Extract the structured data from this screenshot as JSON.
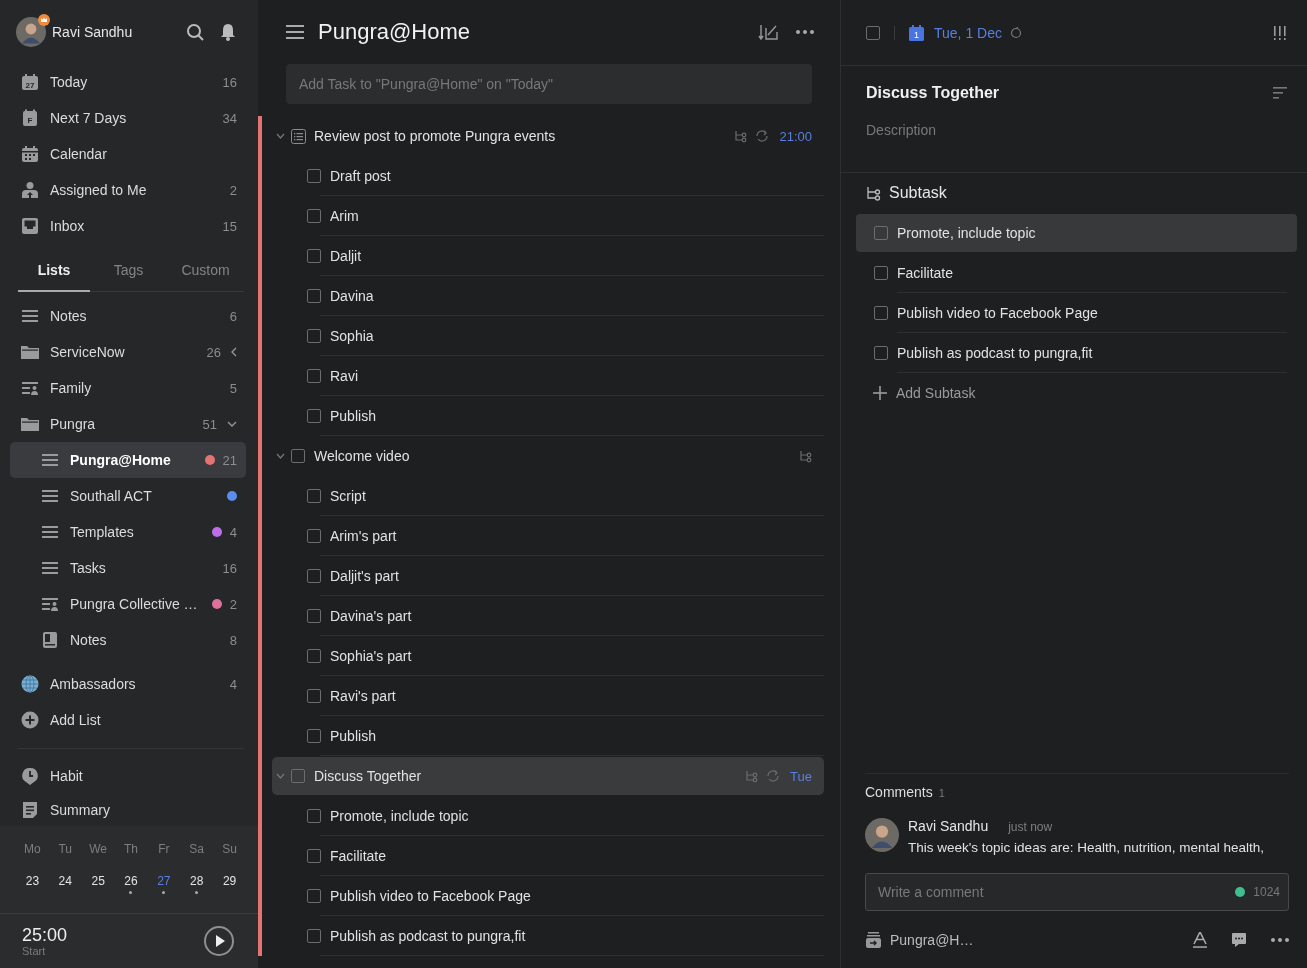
{
  "sidebar": {
    "user": {
      "name": "Ravi Sandhu"
    },
    "smart_lists": [
      {
        "kind": "today",
        "icon_text": "27",
        "label": "Today",
        "count": "16"
      },
      {
        "kind": "week",
        "icon_text": "F",
        "label": "Next 7 Days",
        "count": "34"
      },
      {
        "kind": "calendar",
        "label": "Calendar"
      },
      {
        "kind": "assigned",
        "label": "Assigned to Me",
        "count": "2"
      },
      {
        "kind": "inbox",
        "label": "Inbox",
        "count": "15"
      }
    ],
    "tabs": [
      {
        "label": "Lists",
        "selected": true
      },
      {
        "label": "Tags",
        "selected": false
      },
      {
        "label": "Custom",
        "selected": false
      }
    ],
    "lists": [
      {
        "kind": "list",
        "label": "Notes",
        "count": "6",
        "selected": false
      },
      {
        "kind": "folder",
        "label": "ServiceNow",
        "count": "26",
        "expanded": false,
        "selected": false
      },
      {
        "kind": "shared",
        "label": "Family",
        "count": "5",
        "selected": false
      },
      {
        "kind": "folder",
        "label": "Pungra",
        "count": "51",
        "expanded": true,
        "selected": false,
        "children": [
          {
            "kind": "list",
            "label": "Pungra@Home",
            "color": "#e57373",
            "count": "21",
            "selected": true
          },
          {
            "kind": "list",
            "label": "Southall ACT",
            "color": "#5b8def",
            "selected": false
          },
          {
            "kind": "list",
            "label": "Templates",
            "color": "#c06ee8",
            "count": "4",
            "selected": false
          },
          {
            "kind": "list",
            "label": "Tasks",
            "count": "16",
            "selected": false
          },
          {
            "kind": "shared",
            "label": "Pungra Collective …",
            "color": "#e0709a",
            "count": "2",
            "selected": false
          },
          {
            "kind": "notebook",
            "label": "Notes",
            "count": "8",
            "selected": false
          }
        ]
      },
      {
        "kind": "globe",
        "label": "Ambassadors",
        "count": "4",
        "selected": false
      },
      {
        "kind": "add",
        "label": "Add List",
        "selected": false
      }
    ],
    "extras": [
      {
        "kind": "habit",
        "label": "Habit"
      },
      {
        "kind": "summary",
        "label": "Summary"
      }
    ],
    "week": [
      {
        "weekday": "Mo",
        "date": "23",
        "selected": false,
        "has_tasks": false
      },
      {
        "weekday": "Tu",
        "date": "24",
        "selected": false,
        "has_tasks": false
      },
      {
        "weekday": "We",
        "date": "25",
        "selected": false,
        "has_tasks": false
      },
      {
        "weekday": "Th",
        "date": "26",
        "selected": false,
        "has_tasks": true
      },
      {
        "weekday": "Fr",
        "date": "27",
        "selected": true,
        "has_tasks": true
      },
      {
        "weekday": "Sa",
        "date": "28",
        "selected": false,
        "has_tasks": true
      },
      {
        "weekday": "Su",
        "date": "29",
        "selected": false,
        "has_tasks": false
      }
    ],
    "pomodoro": {
      "time": "25:00",
      "action": "Start"
    }
  },
  "list": {
    "title": "Pungra@Home",
    "add_placeholder": "Add Task to \"Pungra@Home\" on \"Today\"",
    "tasks": [
      {
        "kind": "note",
        "title": "Review post to promote Pungra events",
        "checked": false,
        "expanded": true,
        "selected": false,
        "repeat": true,
        "due": "21:00",
        "children": [
          {
            "title": "Draft post",
            "checked": false
          },
          {
            "title": "Arim",
            "checked": false
          },
          {
            "title": "Daljit",
            "checked": false
          },
          {
            "title": "Davina",
            "checked": false
          },
          {
            "title": "Sophia",
            "checked": false
          },
          {
            "title": "Ravi",
            "checked": false
          },
          {
            "title": "Publish",
            "checked": false
          }
        ]
      },
      {
        "kind": "task",
        "title": "Welcome video",
        "checked": false,
        "expanded": true,
        "selected": false,
        "repeat": false,
        "children": [
          {
            "title": "Script",
            "checked": false
          },
          {
            "title": "Arim's part",
            "checked": false
          },
          {
            "title": "Daljit's part",
            "checked": false
          },
          {
            "title": "Davina's part",
            "checked": false
          },
          {
            "title": "Sophia's part",
            "checked": false
          },
          {
            "title": "Ravi's part",
            "checked": false
          },
          {
            "title": "Publish",
            "checked": false
          }
        ]
      },
      {
        "kind": "task",
        "title": "Discuss Together",
        "checked": false,
        "expanded": true,
        "selected": true,
        "repeat": true,
        "due": "Tue",
        "children": [
          {
            "title": "Promote, include topic",
            "checked": false
          },
          {
            "title": "Facilitate",
            "checked": false
          },
          {
            "title": "Publish video to Facebook Page",
            "checked": false
          },
          {
            "title": "Publish as podcast to pungra,fit",
            "checked": false
          }
        ]
      }
    ]
  },
  "detail": {
    "checked": false,
    "icon_text": "1",
    "date": "Tue, 1 Dec",
    "repeat": true,
    "title": "Discuss Together",
    "description_placeholder": "Description",
    "subtask_heading": "Subtask",
    "subtasks": [
      {
        "title": "Promote, include topic",
        "checked": false,
        "selected": true
      },
      {
        "title": "Facilitate",
        "checked": false,
        "selected": false
      },
      {
        "title": "Publish video to Facebook Page",
        "checked": false,
        "selected": false
      },
      {
        "title": "Publish as podcast to pungra,fit",
        "checked": false,
        "selected": false
      }
    ],
    "add_subtask": "Add Subtask",
    "comments": {
      "heading": "Comments",
      "count": "1",
      "items": [
        {
          "author": "Ravi Sandhu",
          "time": "just now",
          "text": "This week's topic ideas are: Health, nutrition, mental health,"
        }
      ]
    },
    "comment_placeholder": "Write a comment",
    "char_limit": "1024",
    "list_name": "Pungra@H…"
  }
}
